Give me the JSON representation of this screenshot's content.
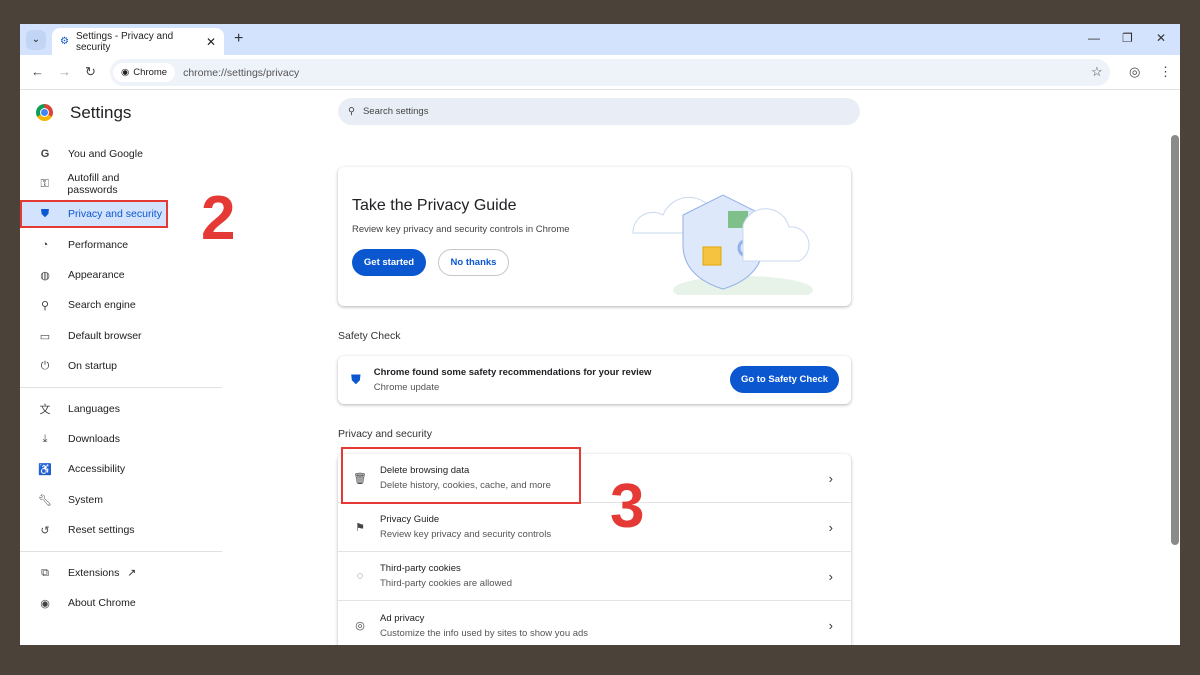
{
  "browser": {
    "tab_title": "Settings - Privacy and security",
    "chip_label": "Chrome",
    "url": "chrome://settings/privacy"
  },
  "header": {
    "title": "Settings",
    "search_placeholder": "Search settings"
  },
  "sidebar": {
    "items": [
      {
        "label": "You and Google",
        "icon": "google-icon"
      },
      {
        "label": "Autofill and passwords",
        "icon": "key-icon"
      },
      {
        "label": "Privacy and security",
        "icon": "shield-icon"
      },
      {
        "label": "Performance",
        "icon": "speedometer-icon"
      },
      {
        "label": "Appearance",
        "icon": "palette-icon"
      },
      {
        "label": "Search engine",
        "icon": "search-icon"
      },
      {
        "label": "Default browser",
        "icon": "browser-icon"
      },
      {
        "label": "On startup",
        "icon": "power-icon"
      },
      {
        "label": "Languages",
        "icon": "translate-icon"
      },
      {
        "label": "Downloads",
        "icon": "download-icon"
      },
      {
        "label": "Accessibility",
        "icon": "accessibility-icon"
      },
      {
        "label": "System",
        "icon": "wrench-icon"
      },
      {
        "label": "Reset settings",
        "icon": "reset-icon"
      },
      {
        "label": "Extensions",
        "icon": "puzzle-icon"
      },
      {
        "label": "About Chrome",
        "icon": "chrome-icon"
      }
    ]
  },
  "annotations": {
    "step2": "2",
    "step3": "3"
  },
  "privacy_guide": {
    "title": "Take the Privacy Guide",
    "subtitle": "Review key privacy and security controls in Chrome",
    "get_started": "Get started",
    "no_thanks": "No thanks"
  },
  "safety_check": {
    "section": "Safety Check",
    "message": "Chrome found some safety recommendations for your review",
    "detail": "Chrome update",
    "button": "Go to Safety Check"
  },
  "privacy_section": {
    "heading": "Privacy and security",
    "rows": [
      {
        "title": "Delete browsing data",
        "subtitle": "Delete history, cookies, cache, and more"
      },
      {
        "title": "Privacy Guide",
        "subtitle": "Review key privacy and security controls"
      },
      {
        "title": "Third-party cookies",
        "subtitle": "Third-party cookies are allowed"
      },
      {
        "title": "Ad privacy",
        "subtitle": "Customize the info used by sites to show you ads"
      }
    ]
  },
  "colors": {
    "accent": "#0b57d0",
    "annotation": "#e53935"
  }
}
